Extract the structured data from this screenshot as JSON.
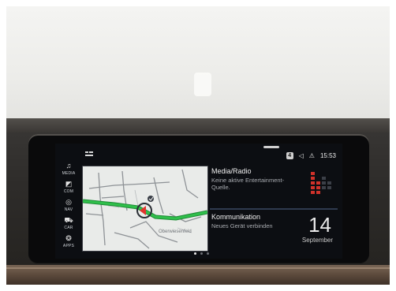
{
  "status": {
    "badge": "4",
    "time": "15:53"
  },
  "sidebar": {
    "items": [
      {
        "label": "MEDIA",
        "icon": "music-note-icon"
      },
      {
        "label": "COM",
        "icon": "phone-icon"
      },
      {
        "label": "NAV",
        "icon": "navigation-icon"
      },
      {
        "label": "CAR",
        "icon": "car-icon"
      },
      {
        "label": "APPS",
        "icon": "apps-icon"
      }
    ]
  },
  "map": {
    "street_label": "Oberwiesenfeld"
  },
  "media": {
    "title": "Media/Radio",
    "subtitle_line1": "Keine aktive Entertainment-",
    "subtitle_line2": "Quelle."
  },
  "communication": {
    "title": "Kommunikation",
    "subtitle": "Neues Gerät verbinden"
  },
  "date": {
    "day": "14",
    "month": "September"
  },
  "pager": {
    "count": 3,
    "active": 0
  },
  "colors": {
    "route": "#2fbf4a",
    "accent": "#e0332b",
    "tile_bg": "#1b2230"
  }
}
